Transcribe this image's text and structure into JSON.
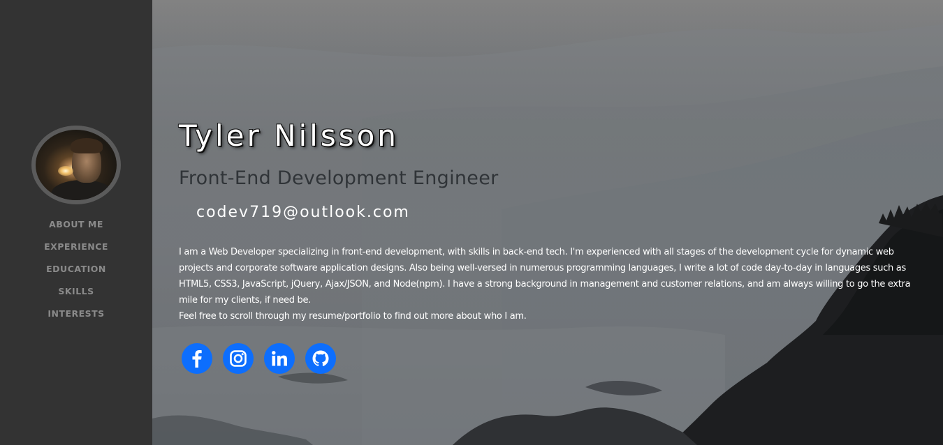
{
  "sidebar": {
    "nav": [
      {
        "label": "About Me"
      },
      {
        "label": "Experience"
      },
      {
        "label": "Education"
      },
      {
        "label": "Skills"
      },
      {
        "label": "Interests"
      }
    ]
  },
  "hero": {
    "name": "Tyler Nilsson",
    "role": "Front-End Development Engineer",
    "email": "codev719@outlook.com",
    "bio": [
      "I am a Web Developer specializing in front-end development, with skills in back-end tech. I'm experienced with all stages of the development cycle for dynamic web projects and corporate software application designs. Also being well-versed in numerous programming languages, I write a lot of code day-to-day in languages such as HTML5, CSS3, JavaScript, jQuery, Ajax/JSON, and Node(npm). I have a strong background in management and customer relations, and am always willing to go the extra mile for my clients, if need be.",
      "Feel free to scroll through my resume/portfolio to find out more about who I am."
    ]
  },
  "social": {
    "links": [
      {
        "icon": "facebook-icon"
      },
      {
        "icon": "instagram-icon"
      },
      {
        "icon": "linkedin-icon"
      },
      {
        "icon": "github-icon"
      }
    ]
  },
  "colors": {
    "sidebar_bg": "#333333",
    "nav_text": "#8a8a8a",
    "social_button": "#0d6efd",
    "role_text": "#303438"
  }
}
